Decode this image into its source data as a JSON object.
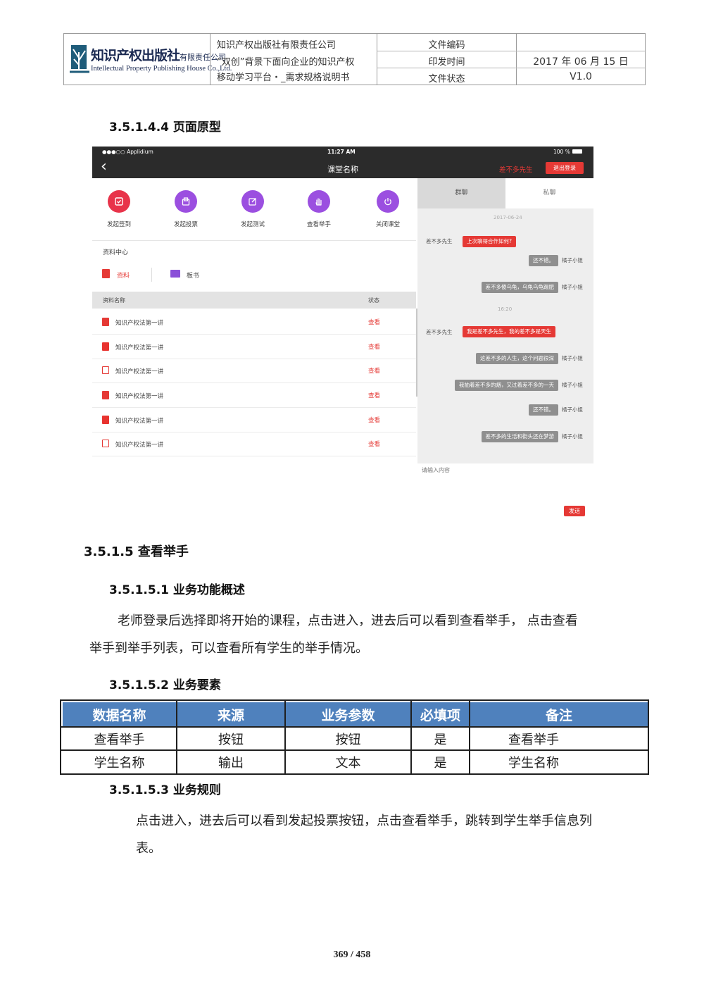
{
  "header": {
    "logo": {
      "cn_name": "知识产权出版社",
      "cn_suffix": "有限责任公司",
      "en_name": "Intellectual Property Publishing House Co.,Ltd."
    },
    "company": "知识产权出版社有限责任公司",
    "project_line1": "“双创”背景下面向企业的知识产权",
    "project_line2": "移动学习平台・_需求规格说明书",
    "doc_code_label": "文件编码",
    "doc_code_value": "",
    "print_time_label": "印发时间",
    "print_time_value": "2017 年 06 月 15 日",
    "status_label": "文件状态",
    "status_value": "V1.0"
  },
  "section_prototype": "3.5.1.4.4 页面原型",
  "mockup": {
    "statusbar": {
      "carrier": "●●●○○ Applidium",
      "time": "11:27 AM",
      "battery": "100 %"
    },
    "navbar": {
      "back": "‹",
      "title": "课堂名称",
      "user": "差不多先生",
      "logout": "退出登录"
    },
    "tools": [
      {
        "label": "发起签到",
        "icon": "checkin-icon",
        "color": "#e8334a"
      },
      {
        "label": "发起投票",
        "icon": "vote-icon",
        "color": "#9b4fe0"
      },
      {
        "label": "发起测试",
        "icon": "edit-icon",
        "color": "#9b4fe0"
      },
      {
        "label": "查看举手",
        "icon": "hand-icon",
        "color": "#9b4fe0"
      },
      {
        "label": "关闭课堂",
        "icon": "power-icon",
        "color": "#9b4fe0"
      }
    ],
    "resource_center": "资料中心",
    "resource_tabs": [
      "资料",
      "板书"
    ],
    "list_header": {
      "name": "资料名称",
      "status": "状态"
    },
    "files": [
      {
        "name": "知识产权法第一讲",
        "action": "查看",
        "type": "txt"
      },
      {
        "name": "知识产权法第一讲",
        "action": "查看",
        "type": "pdf"
      },
      {
        "name": "知识产权法第一讲",
        "action": "查看",
        "type": "ppt"
      },
      {
        "name": "知识产权法第一讲",
        "action": "查看",
        "type": "txt"
      },
      {
        "name": "知识产权法第一讲",
        "action": "查看",
        "type": "pdf"
      },
      {
        "name": "知识产权法第一讲",
        "action": "查看",
        "type": "ppt"
      }
    ],
    "chat": {
      "tabs": [
        "群聊",
        "私聊"
      ],
      "date": "2017-06-24",
      "time2": "16:20",
      "messages": [
        {
          "user": "差不多先生",
          "text": "上次聊得合作如何?",
          "side": "left"
        },
        {
          "user": "橘子小姐",
          "text": "还不错。",
          "side": "right"
        },
        {
          "user": "橘子小姐",
          "text": "差不多傻乌龟，乌龟乌龟踢肥",
          "side": "right"
        },
        {
          "user": "差不多先生",
          "text": "我是差不多先生，我的差不多是天生",
          "side": "left"
        },
        {
          "user": "橘子小姐",
          "text": "这差不多的人生，这个问题很深",
          "side": "right"
        },
        {
          "user": "橘子小姐",
          "text": "我抽着差不多的烟，又过着差不多的一天",
          "side": "right"
        },
        {
          "user": "橘子小姐",
          "text": "还不错。",
          "side": "right"
        },
        {
          "user": "橘子小姐",
          "text": "差不多的生活和街头还在梦游",
          "side": "right"
        }
      ],
      "input_placeholder": "请输入内容",
      "send": "发送"
    }
  },
  "section_raise": "3.5.1.5 查看举手",
  "section_overview": "3.5.1.5.1 业务功能概述",
  "overview_line1": "老师登录后选择即将开始的课程，点击进入，进去后可以看到查看举手，  点击查看",
  "overview_line2": "举手到举手列表，可以查看所有学生的举手情况。",
  "section_elements": "3.5.1.5.2 业务要素",
  "table": {
    "headers": [
      "数据名称",
      "来源",
      "业务参数",
      "必填项",
      "备注"
    ],
    "rows": [
      [
        "查看举手",
        "按钮",
        "按钮",
        "是",
        "查看举手"
      ],
      [
        "学生名称",
        "输出",
        "文本",
        "是",
        "学生名称"
      ]
    ]
  },
  "section_rules": "3.5.1.5.3 业务规则",
  "rules_line1": "点击进入，进去后可以看到发起投票按钮，点击查看举手，跳转到学生举手信息列",
  "rules_line2": "表。",
  "page_number": "369 / 458"
}
